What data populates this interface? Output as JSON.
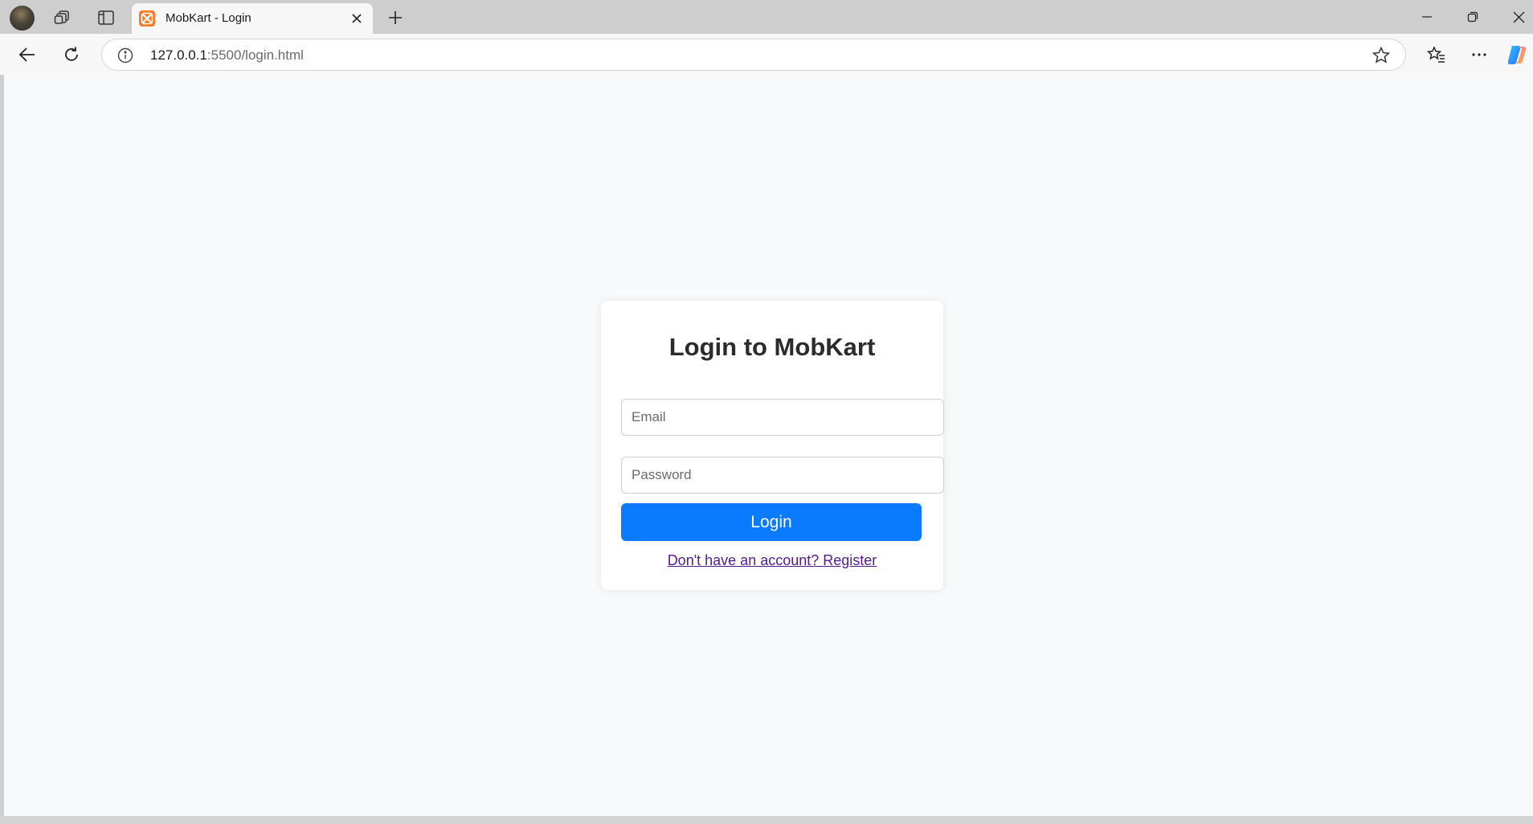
{
  "browser": {
    "tab": {
      "title": "MobKart - Login"
    },
    "address_bar": {
      "url_host": "127.0.0.1",
      "url_rest": ":5500/login.html"
    },
    "icons": {
      "profile": "profile-avatar",
      "workspaces": "workspaces-icon",
      "vertical_tabs": "vertical-tabs-icon",
      "tab_favicon": "xampp-favicon",
      "tab_close": "close-icon",
      "new_tab": "plus-icon",
      "minimize": "minimize-icon",
      "restore": "restore-icon",
      "close_window": "close-icon",
      "back": "back-arrow-icon",
      "refresh": "refresh-icon",
      "site_info": "info-icon",
      "favorite": "star-icon",
      "favorites": "favorites-icon",
      "more": "more-icon",
      "copilot": "copilot-icon"
    }
  },
  "page": {
    "background_color": "#f8f9fa",
    "login_card": {
      "title": "Login to MobKart",
      "email_placeholder": "Email",
      "email_value": "",
      "password_placeholder": "Password",
      "password_value": "",
      "login_button": "Login",
      "register_link": "Don't have an account? Register"
    },
    "colors": {
      "button": "#0a7bff",
      "link": "#551a8b"
    }
  }
}
